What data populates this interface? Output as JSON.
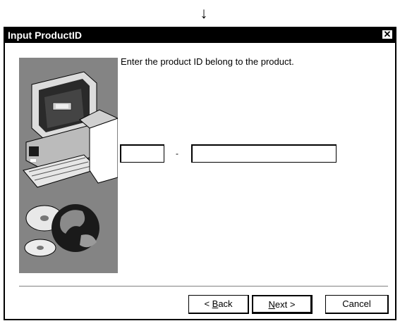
{
  "arrow": "↓",
  "dialog": {
    "title": "Input ProductID",
    "close_glyph": "✕",
    "prompt": "Enter the product ID belong to the product.",
    "separator": "-",
    "field1_value": "",
    "field2_value": "",
    "buttons": {
      "back": {
        "prefix": "< ",
        "mnemonic": "B",
        "rest": "ack"
      },
      "next": {
        "mnemonic": "N",
        "rest": "ext >"
      },
      "cancel": "Cancel"
    }
  },
  "colors": {
    "title_bar": "#000000",
    "art_panel": "#848484"
  },
  "icons": [
    "computer-illustration",
    "cd-disc-icon",
    "globe-icon",
    "close-icon"
  ]
}
